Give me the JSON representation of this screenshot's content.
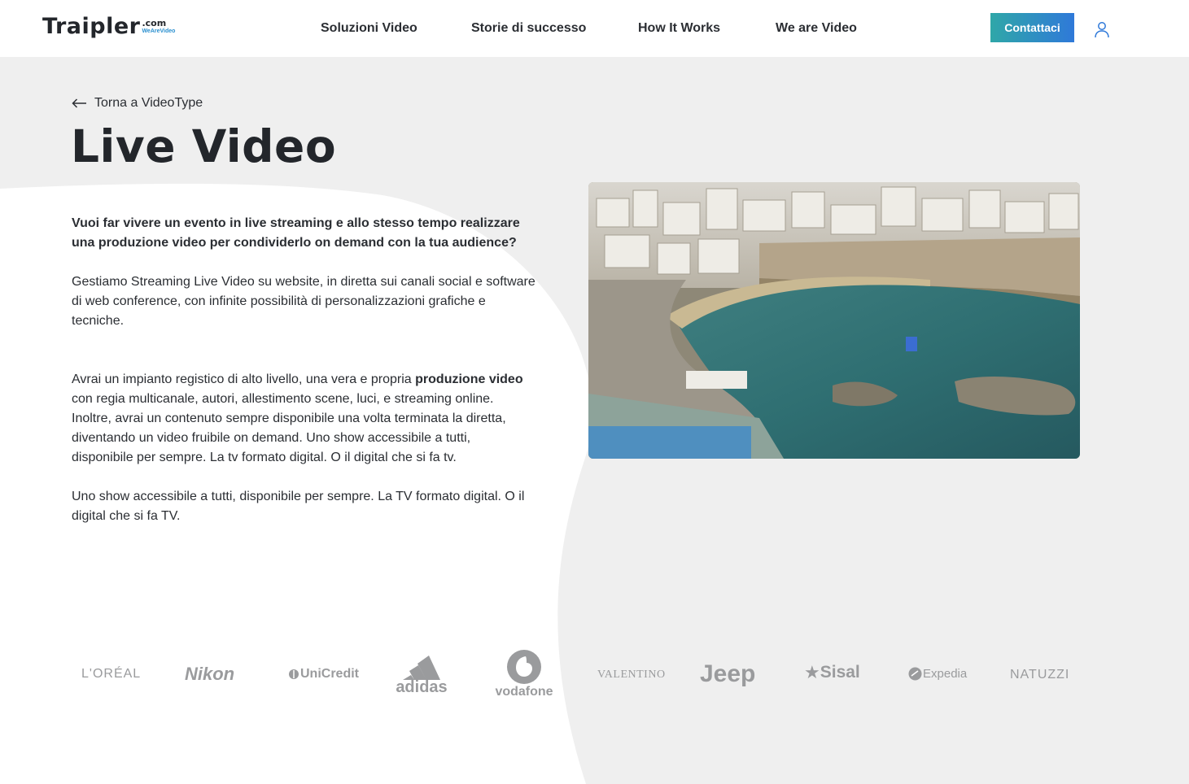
{
  "header": {
    "logo": {
      "name": "Traipler",
      "suffix": ".com",
      "tagline": "WeAreVideo"
    },
    "nav": [
      "Soluzioni Video",
      "Storie di successo",
      "How It Works",
      "We are Video"
    ],
    "contact_button": "Contattaci",
    "user_icon": "user-icon"
  },
  "main": {
    "back_link": "Torna a VideoType",
    "title": "Live Video",
    "intro": "Vuoi far vivere un evento in live streaming e allo stesso tempo realizzare una produzione video per condividerlo on demand con la tua audience?",
    "paragraph1": "Gestiamo Streaming Live Video su website, in diretta sui canali social e software di web conference, con infinite possibilità di personalizzazioni grafiche e tecniche.",
    "paragraph2_pre": "Avrai un impianto registico di alto livello, una vera e propria ",
    "paragraph2_bold": "produzione video",
    "paragraph2_post": " con regia multicanale, autori, allestimento scene, luci, e streaming online. Inoltre, avrai un contenuto sempre disponibile una volta terminata la diretta, diventando un video fruibile on demand. Uno show accessibile a tutti, disponibile per sempre. La tv formato digital. O il digital che si fa tv.",
    "paragraph3": "Uno show accessibile a tutti, disponibile per sempre. La TV formato digital. O il digital che si fa TV.",
    "image_alt": "aerial-coastal-town-bay"
  },
  "clients": {
    "loreal": "L'ORÉAL",
    "nikon": "Nikon",
    "unicredit": "UniCredit",
    "adidas": "adidas",
    "vodafone": "vodafone",
    "valentino": "VALENTINO",
    "jeep": "Jeep",
    "sisal": "Sisal",
    "expedia": "Expedia",
    "natuzzi": "NATUZZI"
  },
  "colors": {
    "accent_gradient_start": "#2fa7a8",
    "accent_gradient_end": "#2f79d9",
    "text_dark": "#23262b",
    "logo_gray": "#9a9b9d",
    "page_bg": "#efefef"
  }
}
